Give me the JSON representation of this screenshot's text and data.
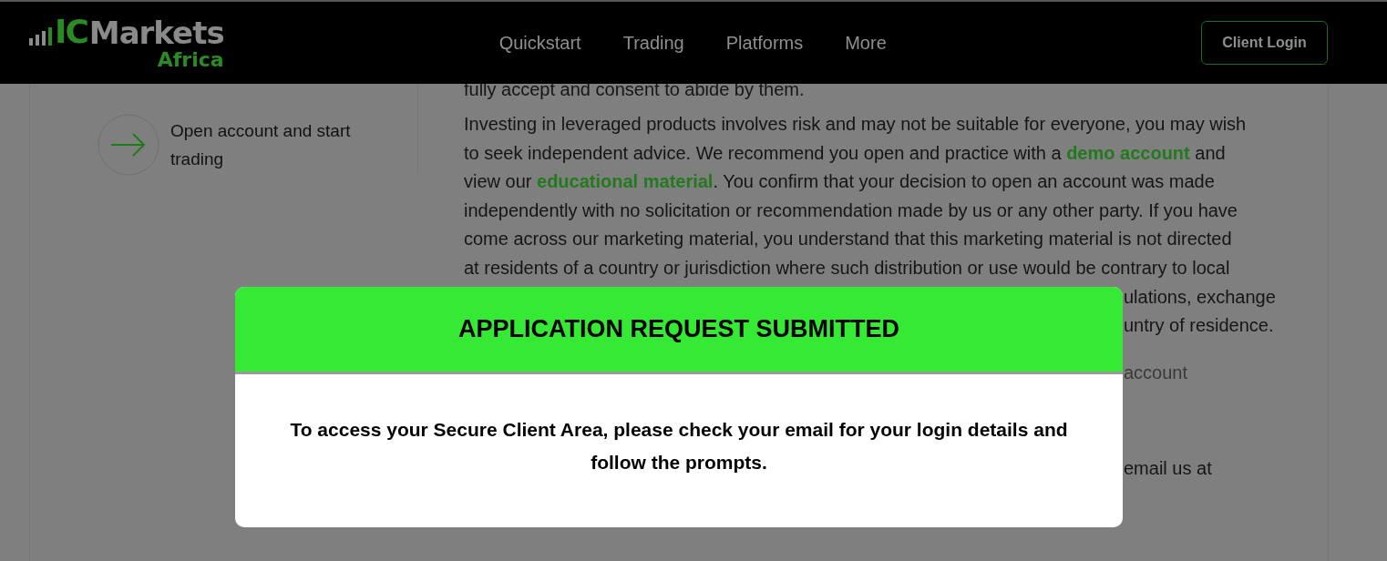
{
  "header": {
    "logo": {
      "mark": "IC",
      "name": "Markets",
      "region": "Africa"
    },
    "nav": [
      {
        "label": "Quickstart"
      },
      {
        "label": "Trading"
      },
      {
        "label": "Platforms"
      },
      {
        "label": "More"
      }
    ],
    "login_button": "Client Login"
  },
  "sidebar": {
    "step": "Open account and start trading"
  },
  "content": {
    "cut_line": "fully accept and consent to abide by them.",
    "paragraph_lines": [
      "Investing in leveraged products involves risk and may not be suitable for everyone, you may wish",
      "to seek independent advice. We recommend you open and practice with a **demo account** and",
      "view our **educational material**. You confirm that your decision to open an account was made",
      "independently with no solicitation or recommendation made by us or any other party. If you have",
      "come across our marketing material, you understand that this marketing material is not directed",
      "at residents of a country or jurisdiction where such distribution or use would be contrary to local"
    ],
    "hidden_fragments": [
      {
        "text": "ulations, exchange",
        "kind": "line"
      },
      {
        "text": "untry of residence.",
        "kind": "line"
      },
      {
        "text": "account",
        "kind": "muted"
      },
      {
        "text": "email us at",
        "kind": "spaced"
      }
    ]
  },
  "modal": {
    "title": "APPLICATION REQUEST SUBMITTED",
    "message": "To access your Secure Client Area, please check your email for your login details and follow the prompts."
  }
}
